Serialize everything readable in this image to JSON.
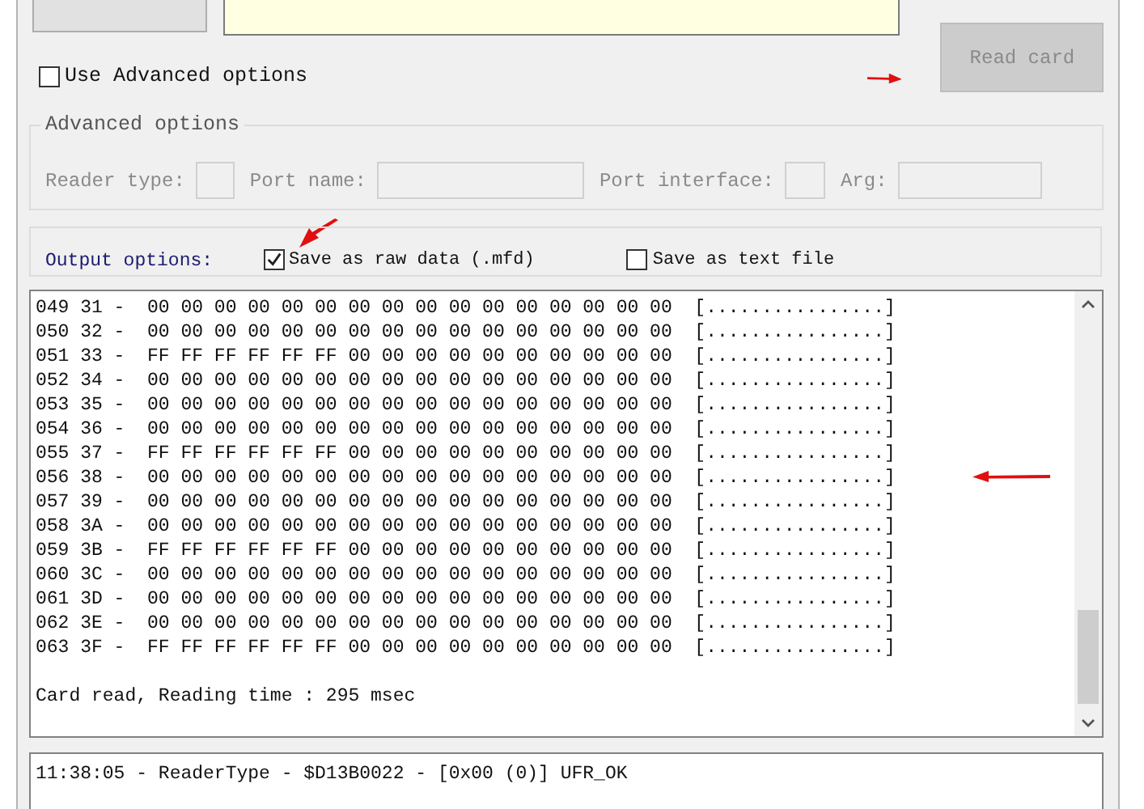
{
  "read_button": {
    "label": "Read card",
    "disabled": true
  },
  "use_advanced": {
    "label": "Use Advanced options",
    "checked": false
  },
  "advanced_options": {
    "title": "Advanced options",
    "disabled": true,
    "fields": [
      {
        "label": "Reader type:"
      },
      {
        "label": "Port name:"
      },
      {
        "label": "Port interface:"
      },
      {
        "label": "Arg:"
      }
    ]
  },
  "output_options": {
    "label": "Output options:",
    "choices": [
      {
        "label": "Save as raw data (.mfd)",
        "checked": true
      },
      {
        "label": "Save as text file",
        "checked": false
      }
    ]
  },
  "hex_dump": {
    "lines": [
      "049 31 -  00 00 00 00 00 00 00 00 00 00 00 00 00 00 00 00  [................]",
      "050 32 -  00 00 00 00 00 00 00 00 00 00 00 00 00 00 00 00  [................]",
      "051 33 -  FF FF FF FF FF FF 00 00 00 00 00 00 00 00 00 00  [................]",
      "052 34 -  00 00 00 00 00 00 00 00 00 00 00 00 00 00 00 00  [................]",
      "053 35 -  00 00 00 00 00 00 00 00 00 00 00 00 00 00 00 00  [................]",
      "054 36 -  00 00 00 00 00 00 00 00 00 00 00 00 00 00 00 00  [................]",
      "055 37 -  FF FF FF FF FF FF 00 00 00 00 00 00 00 00 00 00  [................]",
      "056 38 -  00 00 00 00 00 00 00 00 00 00 00 00 00 00 00 00  [................]",
      "057 39 -  00 00 00 00 00 00 00 00 00 00 00 00 00 00 00 00  [................]",
      "058 3A -  00 00 00 00 00 00 00 00 00 00 00 00 00 00 00 00  [................]",
      "059 3B -  FF FF FF FF FF FF 00 00 00 00 00 00 00 00 00 00  [................]",
      "060 3C -  00 00 00 00 00 00 00 00 00 00 00 00 00 00 00 00  [................]",
      "061 3D -  00 00 00 00 00 00 00 00 00 00 00 00 00 00 00 00  [................]",
      "062 3E -  00 00 00 00 00 00 00 00 00 00 00 00 00 00 00 00  [................]",
      "063 3F -  FF FF FF FF FF FF 00 00 00 00 00 00 00 00 00 00  [................]"
    ],
    "status": "Card read, Reading time : 295 msec"
  },
  "log": {
    "lines": [
      "11:38:05 - ReaderType - $D13B0022 - [0x00 (0)] UFR_OK"
    ]
  }
}
